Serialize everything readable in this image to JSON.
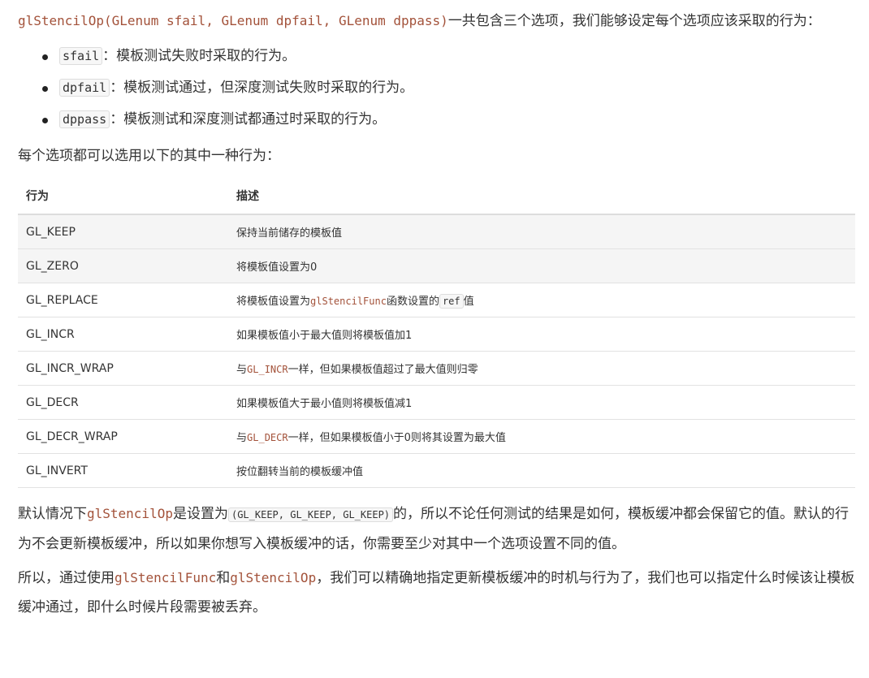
{
  "intro": {
    "func": "glStencilOp(GLenum sfail, GLenum dpfail, GLenum dppass)",
    "text": "一共包含三个选项，我们能够设定每个选项应该采取的行为："
  },
  "options": [
    {
      "code": "sfail",
      "text": "：模板测试失败时采取的行为。"
    },
    {
      "code": "dpfail",
      "text": "：模板测试通过，但深度测试失败时采取的行为。"
    },
    {
      "code": "dppass",
      "text": "：模板测试和深度测试都通过时采取的行为。"
    }
  ],
  "behaviors_intro": "每个选项都可以选用以下的其中一种行为：",
  "table": {
    "headers": [
      "行为",
      "描述"
    ],
    "rows": [
      {
        "action": "GL_KEEP",
        "desc": "保持当前储存的模板值"
      },
      {
        "action": "GL_ZERO",
        "desc": "将模板值设置为0"
      },
      {
        "action": "GL_REPLACE",
        "desc_pre": "将模板值设置为",
        "desc_fn": "glStencilFunc",
        "desc_mid": "函数设置的",
        "desc_code": "ref",
        "desc_post": "值"
      },
      {
        "action": "GL_INCR",
        "desc": "如果模板值小于最大值则将模板值加1"
      },
      {
        "action": "GL_INCR_WRAP",
        "desc_pre": "与",
        "desc_fn": "GL_INCR",
        "desc_post": "一样，但如果模板值超过了最大值则归零"
      },
      {
        "action": "GL_DECR",
        "desc": "如果模板值大于最小值则将模板值减1"
      },
      {
        "action": "GL_DECR_WRAP",
        "desc_pre": "与",
        "desc_fn": "GL_DECR",
        "desc_post": "一样，但如果模板值小于0则将其设置为最大值"
      },
      {
        "action": "GL_INVERT",
        "desc": "按位翻转当前的模板缓冲值"
      }
    ]
  },
  "default_para": {
    "pre": "默认情况下",
    "fn": "glStencilOp",
    "mid": "是设置为",
    "code": "(GL_KEEP, GL_KEEP, GL_KEEP)",
    "post": "的，所以不论任何测试的结果是如何，模板缓冲都会保留它的值。默认的行为不会更新模板缓冲，所以如果你想写入模板缓冲的话，你需要至少对其中一个选项设置不同的值。"
  },
  "final_para": {
    "pre": "所以，通过使用",
    "fn1": "glStencilFunc",
    "mid": "和",
    "fn2": "glStencilOp",
    "post": "，我们可以精确地指定更新模板缓冲的时机与行为了，我们也可以指定什么时候该让模板缓冲通过，即什么时候片段需要被丢弃。"
  }
}
